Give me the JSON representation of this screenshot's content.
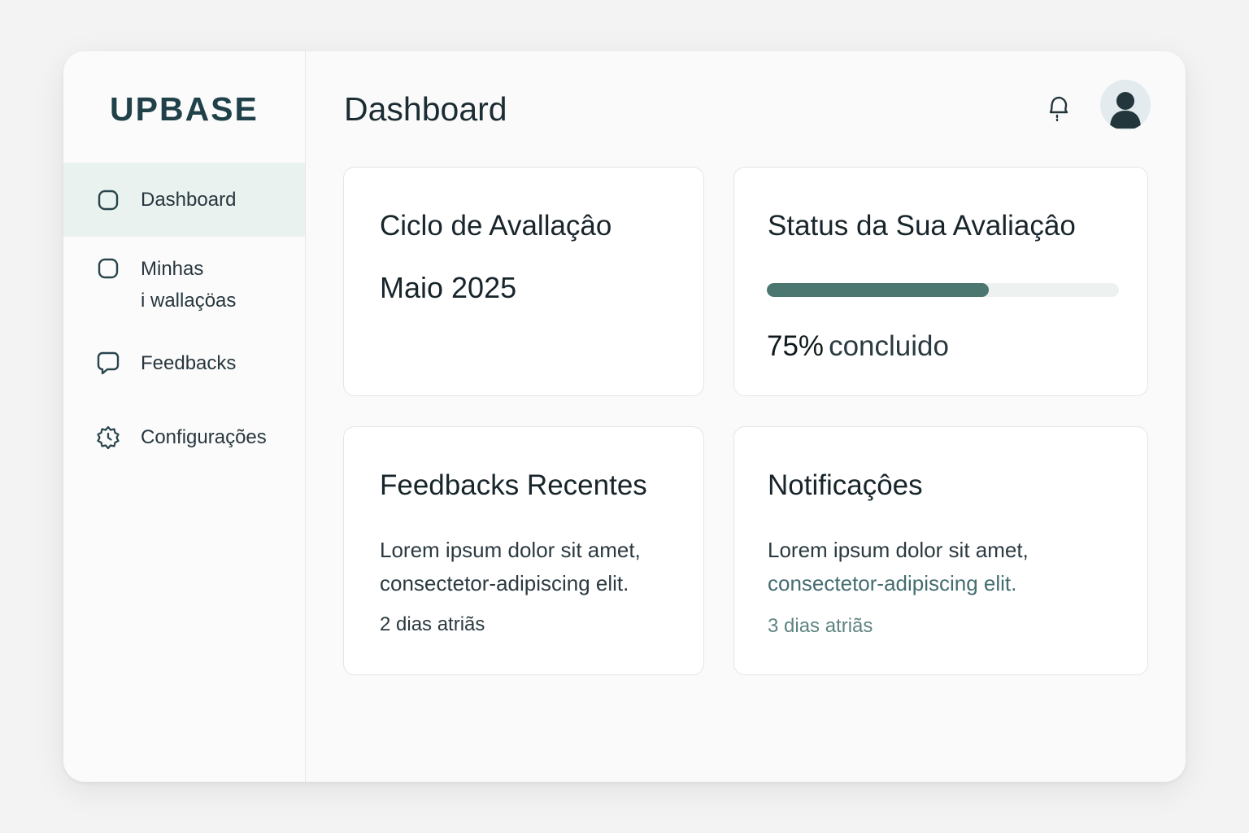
{
  "app": {
    "logo": "UPBASE"
  },
  "sidebar": {
    "items": [
      {
        "label": "Dashboard",
        "icon": "square-icon",
        "active": true
      },
      {
        "label_line1": "Minhas",
        "label_line2": "i wallaçöas",
        "icon": "square-icon"
      },
      {
        "label": "Feedbacks",
        "icon": "chat-icon"
      },
      {
        "label": "Configurações",
        "icon": "gear-icon"
      }
    ]
  },
  "header": {
    "title": "Dashboard",
    "icons": [
      "bell-icon",
      "avatar"
    ]
  },
  "cards": {
    "cycle": {
      "title": "Ciclo de Avallaçâo",
      "value": "Maio 2025"
    },
    "status": {
      "title": "Status da Sua Avaliaçâo",
      "progress": 0.63,
      "percent_label": "75%",
      "percent_suffix": "concluido"
    },
    "feedbacks": {
      "title": "Feedbacks Recentes",
      "text_line1": "Lorem ipsum dolor sit amet,",
      "text_line2": "consectetor-adipiscing elit.",
      "time": "2 dias atriãs"
    },
    "notifications": {
      "title": "Notificaçôes",
      "text_line1": "Lorem ipsum dolor sit amet,",
      "text_line2": "consectetor-adipiscing elit.",
      "time": "3 dias atriãs"
    }
  },
  "colors": {
    "accent": "#4b7770",
    "active_nav_bg": "#e9f2ef",
    "logo": "#21414a"
  }
}
